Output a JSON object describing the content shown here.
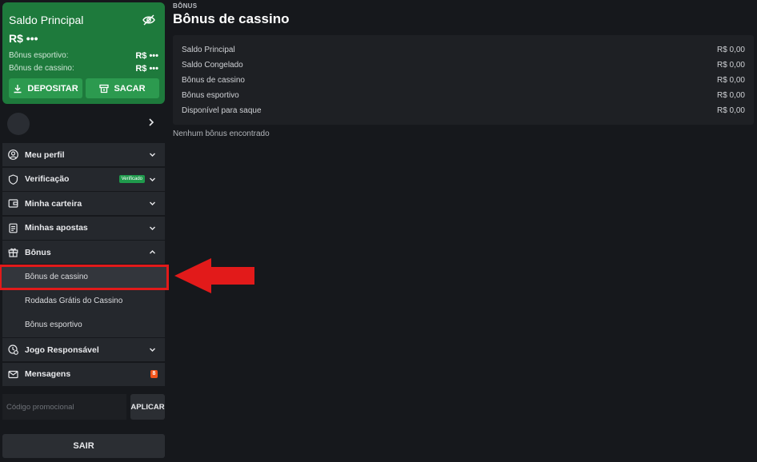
{
  "balance_card": {
    "title": "Saldo Principal",
    "amount": "R$ •••",
    "rows": [
      {
        "label": "Bônus esportivo:",
        "value": "R$ •••"
      },
      {
        "label": "Bônus de cassino:",
        "value": "R$ •••"
      }
    ],
    "deposit_label": "DEPOSITAR",
    "withdraw_label": "SACAR",
    "accent": "#1e7a3c"
  },
  "menu": {
    "items": [
      {
        "label": "Meu perfil",
        "icon": "user-icon"
      },
      {
        "label": "Verificação",
        "icon": "shield-icon",
        "badge": "Verificado"
      },
      {
        "label": "Minha carteira",
        "icon": "wallet-icon"
      },
      {
        "label": "Minhas apostas",
        "icon": "receipt-icon"
      },
      {
        "label": "Bônus",
        "icon": "gift-icon",
        "expanded": true
      }
    ],
    "bonus_sub": [
      {
        "label": "Bônus de cassino",
        "active": true
      },
      {
        "label": "Rodadas Grátis do Cassino"
      },
      {
        "label": "Bônus esportivo"
      }
    ],
    "items_after": [
      {
        "label": "Jogo Responsável",
        "icon": "responsible-gaming-icon"
      },
      {
        "label": "Mensagens",
        "icon": "mail-icon",
        "count": "8"
      }
    ]
  },
  "promo": {
    "placeholder": "Código promocional",
    "apply_label": "APLICAR"
  },
  "logout_label": "SAIR",
  "main": {
    "breadcrumb": "BÔNUS",
    "title": "Bônus de cassino",
    "summary": [
      {
        "label": "Saldo Principal",
        "value": "R$ 0,00"
      },
      {
        "label": "Saldo Congelado",
        "value": "R$ 0,00"
      },
      {
        "label": "Bônus de cassino",
        "value": "R$ 0,00"
      },
      {
        "label": "Bônus esportivo",
        "value": "R$ 0,00"
      },
      {
        "label": "Disponível para saque",
        "value": "R$ 0,00"
      }
    ],
    "empty_text": "Nenhum bônus encontrado"
  },
  "colors": {
    "background": "#16181c",
    "panel": "#25282d",
    "highlight_red": "#e21a1a",
    "badge_green": "#1f9a4c",
    "badge_orange": "#f2541b"
  }
}
